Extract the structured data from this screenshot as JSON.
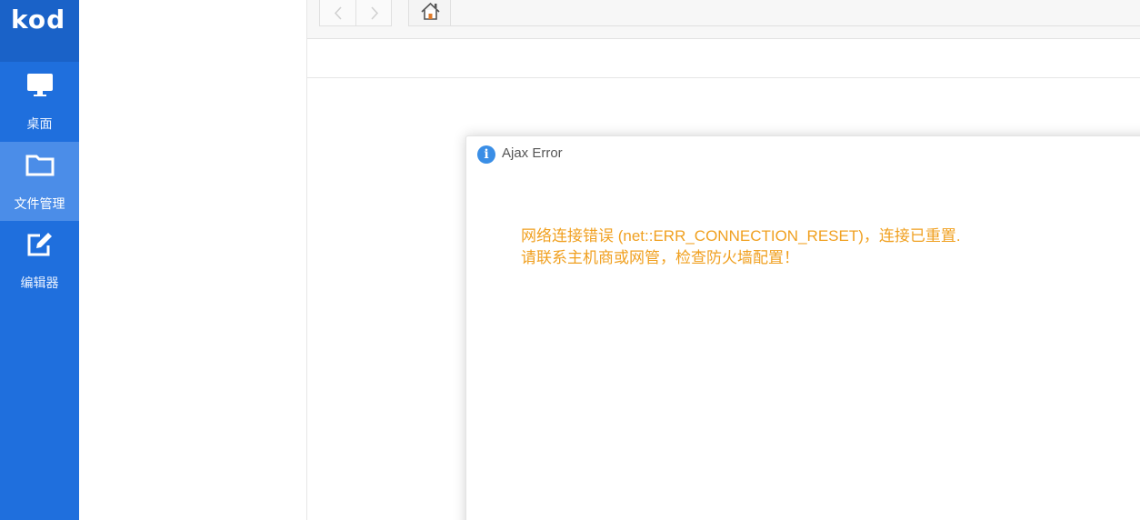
{
  "logo": {
    "text": "kod"
  },
  "sidebar": {
    "items": [
      {
        "label": "桌面",
        "icon": "monitor-icon",
        "active": false
      },
      {
        "label": "文件管理",
        "icon": "folder-icon",
        "active": true
      },
      {
        "label": "编辑器",
        "icon": "edit-icon",
        "active": false
      }
    ]
  },
  "toolbar": {
    "back_icon": "chevron-left-icon",
    "forward_icon": "chevron-right-icon",
    "home_icon": "home-icon"
  },
  "dialog": {
    "title": "Ajax Error",
    "icon": "info-icon",
    "message_line1": "网络连接错误 (net::ERR_CONNECTION_RESET)，连接已重置.",
    "message_line2": "请联系主机商或网管，检查防火墙配置！",
    "message_color": "#f0a020"
  },
  "colors": {
    "rail": "#1f6fdd",
    "rail_active": "#4b8de8",
    "logo_bg": "#1a62c8"
  }
}
